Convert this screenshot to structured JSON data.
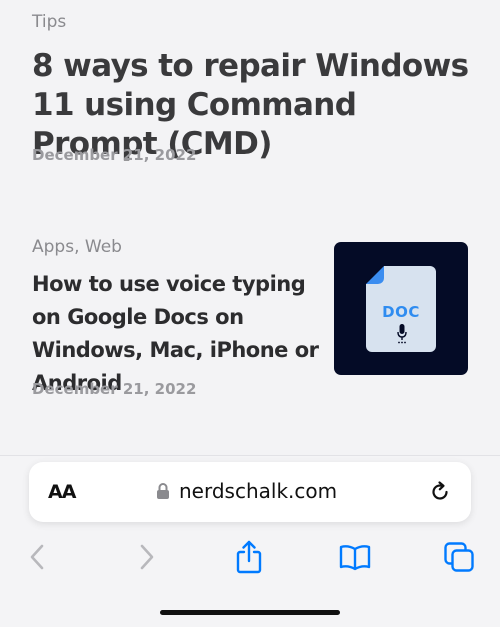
{
  "articles": [
    {
      "category": "Tips",
      "title": "8 ways to repair Windows 11 using Command Prompt (CMD)",
      "date": "December 21, 2022"
    },
    {
      "category": "Apps, Web",
      "title": "How to use voice typing on Google Docs on Windows, Mac, iPhone or Android",
      "date": "December 21, 2022",
      "thumbnail_label": "DOC"
    }
  ],
  "address_bar": {
    "text_size_label": "AA",
    "host": "nerdschalk.com"
  },
  "toolbar": {
    "icons": [
      "back-icon",
      "forward-icon",
      "share-icon",
      "bookmarks-icon",
      "tabs-icon"
    ]
  },
  "colors": {
    "accent": "#007aff",
    "thumbnail_bg": "#040b26",
    "doc_blue": "#2f8cf0"
  }
}
